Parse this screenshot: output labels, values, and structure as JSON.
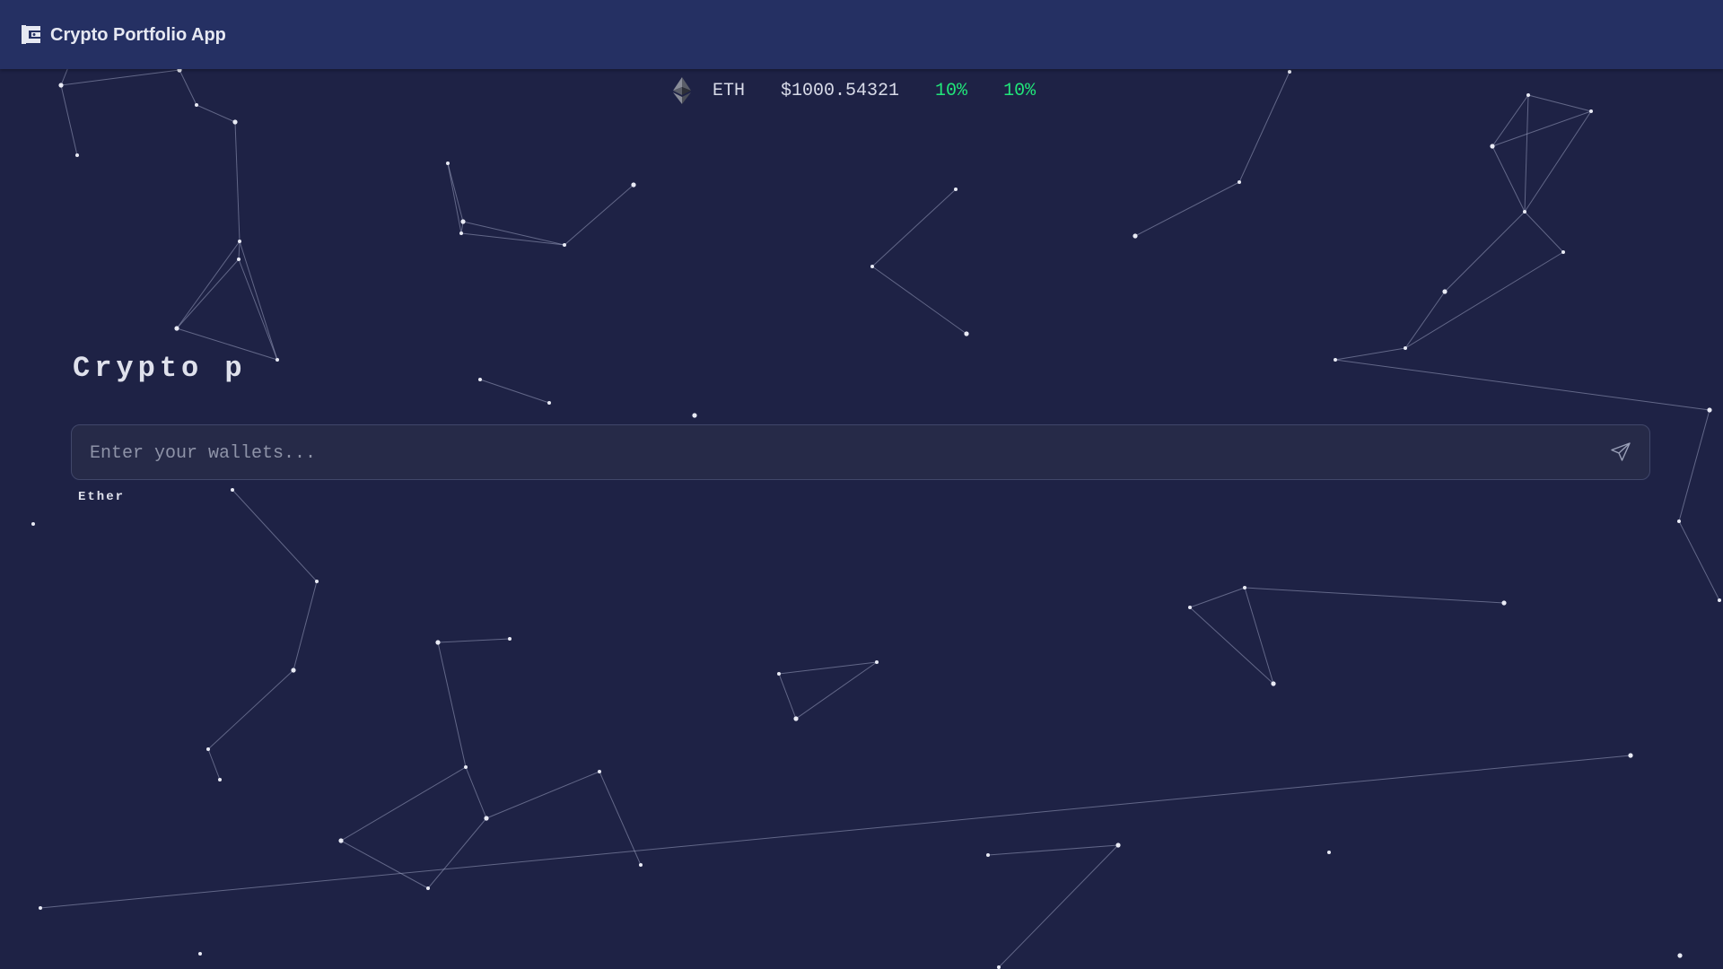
{
  "app": {
    "title": "Crypto Portfolio App"
  },
  "ticker": {
    "icon": "ethereum-icon",
    "symbol": "ETH",
    "price": "$1000.54321",
    "change_1": "10%",
    "change_2": "10%",
    "positive_color": "#21e57a"
  },
  "hero": {
    "title": "Crypto p"
  },
  "wallet_search": {
    "value": "",
    "placeholder": "Enter your wallets...",
    "send_icon": "send-icon"
  },
  "suggestions": [
    {
      "label": "Ether"
    }
  ],
  "colors": {
    "background": "#1e2245",
    "navbar": "#253063"
  }
}
